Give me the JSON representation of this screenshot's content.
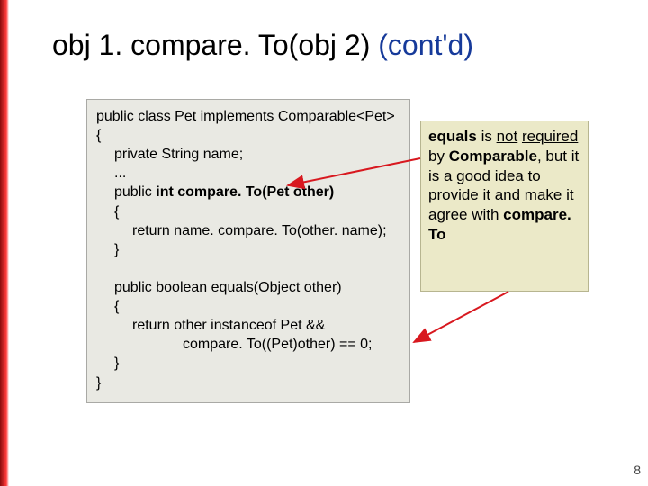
{
  "title": {
    "part1": "obj 1. compare. To(obj 2) ",
    "part2": "(cont'd)"
  },
  "code": {
    "l1": "public class Pet implements Comparable<Pet>",
    "l2": "{",
    "l3": "private String name;",
    "l4": "...",
    "l5a": "public ",
    "l5b": "int",
    "l5c": " compare. To(Pet other)",
    "l6": "{",
    "l7": "return name. compare. To(other. name);",
    "l8": "}",
    "l9": "public boolean equals(Object other)",
    "l10": "{",
    "l11": "return  other instanceof Pet  &&",
    "l12": "compare. To((Pet)other) == 0;",
    "l13": "}",
    "l14": "}"
  },
  "note": {
    "w1": "equals",
    "w2": " is ",
    "w3": "not",
    "w4": "required",
    "w5": " by ",
    "w6": "Comparable",
    "w7": ", but it is a good idea to provide it and make it agree with ",
    "w8": "compare. To"
  },
  "page": "8",
  "colors": {
    "title_blue": "#163a9a",
    "arrow_red": "#d8181f"
  }
}
